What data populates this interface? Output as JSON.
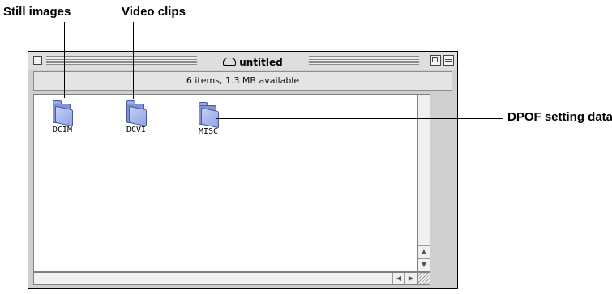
{
  "callouts": {
    "still_images": "Still images",
    "video_clips": "Video clips",
    "dpof": "DPOF setting data"
  },
  "window": {
    "title": "untitled",
    "title_icon": "disk-icon",
    "info": "6 items, 1.3 MB available"
  },
  "folders": [
    {
      "label": "DCIM",
      "icon": "folder-icon"
    },
    {
      "label": "DCVI",
      "icon": "folder-icon"
    },
    {
      "label": "MISC",
      "icon": "folder-icon"
    }
  ],
  "scrollbar": {
    "up": "▲",
    "down": "▼",
    "left": "◀",
    "right": "▶"
  },
  "colors": {
    "folder": "#8fa2e4",
    "window_bg": "#cfcfcf"
  }
}
